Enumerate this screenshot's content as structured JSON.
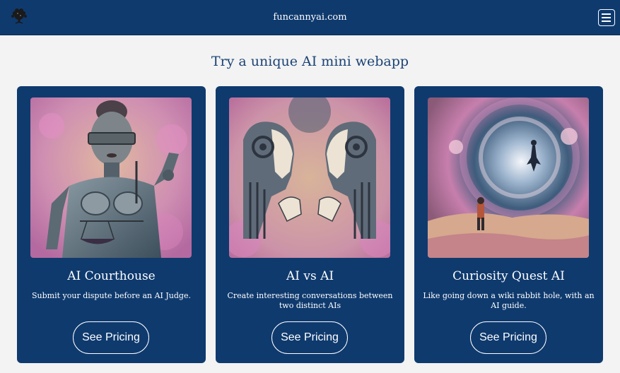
{
  "header": {
    "site_name": "funcannyai.com",
    "logo_icon": "brain-tree-logo",
    "menu_icon": "hamburger-menu-icon"
  },
  "main": {
    "heading": "Try a unique AI mini webapp",
    "cards": [
      {
        "title": "AI Courthouse",
        "description": "Submit your dispute before an AI Judge.",
        "button_label": "See Pricing",
        "image": "blindfolded-robot-justice-with-scales"
      },
      {
        "title": "AI vs AI",
        "description": "Create interesting conversations between two distinct AIs",
        "button_label": "See Pricing",
        "image": "two-robot-faces-facing-each-other"
      },
      {
        "title": "Curiosity Quest AI",
        "description": "Like going down a wiki rabbit hole, with an AI guide.",
        "button_label": "See Pricing",
        "image": "explorer-facing-cosmic-vortex"
      }
    ]
  },
  "colors": {
    "navbar": "#0f3a6e",
    "card": "#0f3a6e",
    "page_bg": "#f3f3f4",
    "heading": "#1b4374",
    "art_pink": "#d77bb4",
    "art_tan": "#c9a48a"
  }
}
